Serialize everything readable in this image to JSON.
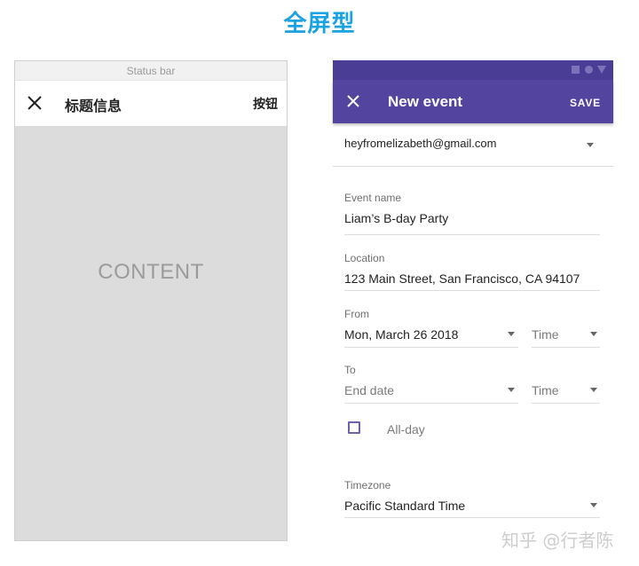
{
  "page_title": "全屏型",
  "wireframe": {
    "status_bar": "Status bar",
    "title": "标题信息",
    "button": "按钮",
    "content": "CONTENT"
  },
  "event_form": {
    "app_title": "New event",
    "save_label": "SAVE",
    "account": "heyfromelizabeth@gmail.com",
    "event_name_label": "Event name",
    "event_name_value": "Liam’s B-day Party",
    "location_label": "Location",
    "location_value": "123 Main Street, San Francisco, CA 94107",
    "from_label": "From",
    "from_date": "Mon, March 26 2018",
    "from_time": "Time",
    "to_label": "To",
    "to_date": "End date",
    "to_time": "Time",
    "all_day_label": "All-day",
    "timezone_label": "Timezone",
    "timezone_value": "Pacific Standard Time"
  },
  "watermark": "知乎 @行者陈",
  "colors": {
    "title_blue": "#1aa3e0",
    "appbar_purple": "#53449f",
    "statusbar_purple": "#4a3d96",
    "wire_gray": "#dcdcdc"
  }
}
